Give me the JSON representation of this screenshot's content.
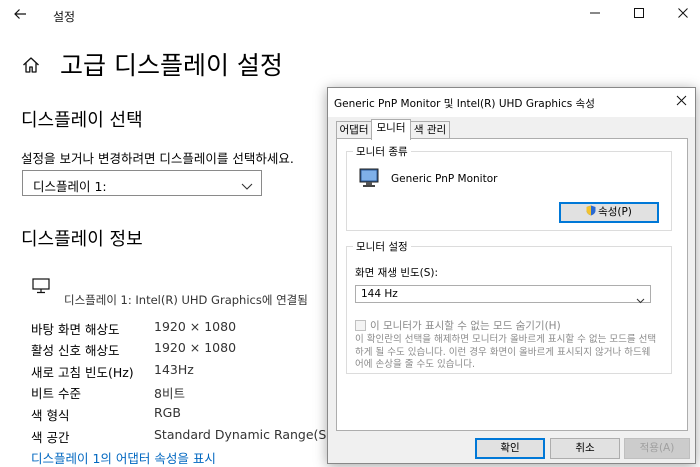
{
  "window": {
    "back_icon": "back-arrow-icon",
    "title": "설정",
    "minimize": "—",
    "maximize": "☐",
    "close": "✕"
  },
  "page": {
    "home_icon": "home-icon",
    "title": "고급 디스플레이 설정",
    "select_section_title": "디스플레이 선택",
    "select_description": "설정을 보거나 변경하려면 디스플레이를 선택하세요.",
    "display_select_value": "디스플레이 1:",
    "info_section_title": "디스플레이 정보",
    "connected_text": "디스플레이 1: Intel(R) UHD Graphics에 연결됨",
    "info_rows": [
      {
        "label": "바탕 화면 해상도",
        "value": "1920 × 1080"
      },
      {
        "label": "활성 신호 해상도",
        "value": "1920 × 1080"
      },
      {
        "label": "새로 고침 빈도(Hz)",
        "value": "143Hz"
      },
      {
        "label": "비트 수준",
        "value": "8비트"
      },
      {
        "label": "색 형식",
        "value": "RGB"
      },
      {
        "label": "색 공간",
        "value": "Standard Dynamic Range(SDR)"
      }
    ],
    "adapter_link": "디스플레이 1의 어댑터 속성을 표시"
  },
  "dialog": {
    "title": "Generic PnP Monitor 및 Intel(R) UHD Graphics 속성",
    "close": "✕",
    "tabs": [
      "어댑터",
      "모니터",
      "색 관리"
    ],
    "active_tab": "모니터",
    "monitor_type_group": "모니터 종류",
    "monitor_name": "Generic PnP Monitor",
    "properties_button": "속성(P)",
    "monitor_settings_group": "모니터 설정",
    "refresh_label": "화면 재생 빈도(S):",
    "refresh_value": "144 Hz",
    "hide_modes_label": "이 모니터가 표시할 수 없는 모드 숨기기(H)",
    "hide_modes_checked": false,
    "note": "이 확인란의 선택을 해제하면 모니터가 올바르게 표시할 수 없는 모드를 선택하게 될 수도 있습니다. 이런 경우 화면이 올바르게 표시되지 않거나 하드웨어에 손상을 줄 수도 있습니다.",
    "ok_button": "확인",
    "cancel_button": "취소",
    "apply_button": "적용(A)"
  },
  "colors": {
    "link": "#0067c0",
    "default_button_border": "#0078d7",
    "dialog_background": "#f0f0f0"
  }
}
